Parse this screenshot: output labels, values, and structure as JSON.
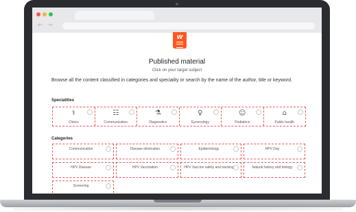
{
  "browser": {
    "back_arrow": "←",
    "forward_arrow": "→"
  },
  "logo": {
    "text": "W",
    "icon": "menu-lines-icon",
    "color": "#ff5722"
  },
  "header": {
    "title": "Published material",
    "subtitle": "Click on your target subject"
  },
  "intro": "Browse all the content classified in categories and speciality or search by the name of the author, title or keyword.",
  "specialities": {
    "heading": "Specialities",
    "items": [
      {
        "label": "Clinics",
        "icon": "stethoscope-icon",
        "glyph": "⚕"
      },
      {
        "label": "Communication",
        "icon": "newspaper-icon",
        "glyph": "☷"
      },
      {
        "label": "Diagnostics",
        "icon": "microscope-icon",
        "glyph": "⚗"
      },
      {
        "label": "Gynecology",
        "icon": "uterus-icon",
        "glyph": "♀"
      },
      {
        "label": "Pediatrics",
        "icon": "child-icon",
        "glyph": "☺"
      },
      {
        "label": "Public health",
        "icon": "building-icon",
        "glyph": "⌂"
      }
    ]
  },
  "categories": {
    "heading": "Categories",
    "items": [
      {
        "label": "Communication"
      },
      {
        "label": "Disease elimination"
      },
      {
        "label": "Epidemiology"
      },
      {
        "label": "HPV Day"
      },
      {
        "label": "HPV Disease"
      },
      {
        "label": "HPV Vaccination"
      },
      {
        "label": "HPV Vaccine safety and tracking"
      },
      {
        "label": "Natural history and biology"
      },
      {
        "label": "Screening"
      }
    ]
  },
  "colors": {
    "accent": "#ff5722",
    "dashed_border": "#e35b5b"
  }
}
